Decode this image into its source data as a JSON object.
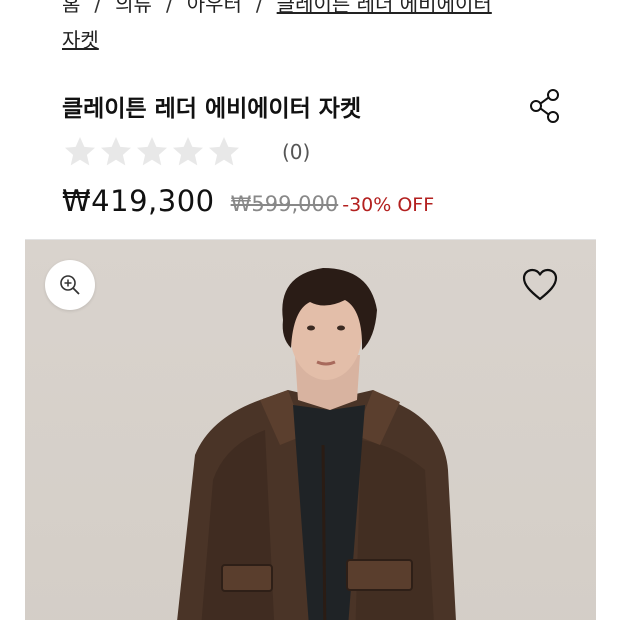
{
  "breadcrumb": {
    "items": [
      "홈",
      "의류",
      "아우터",
      "클레이튼 레더 에비에이터"
    ],
    "current_line2": "자켓",
    "separator": "/"
  },
  "product": {
    "title": "클레이튼 레더 에비에이터 자켓",
    "rating": {
      "stars": 0,
      "max_stars": 5,
      "count_text": "(0)"
    },
    "price": {
      "current": "₩419,300",
      "original": "₩599,000",
      "discount": "-30% OFF"
    }
  },
  "icons": {
    "share": "share-icon",
    "zoom": "zoom-in-icon",
    "wishlist": "heart-icon",
    "star": "star-icon"
  },
  "colors": {
    "discount": "#b3201f",
    "star_empty": "#e8e8e8",
    "image_bg": "#d6d0c9"
  }
}
